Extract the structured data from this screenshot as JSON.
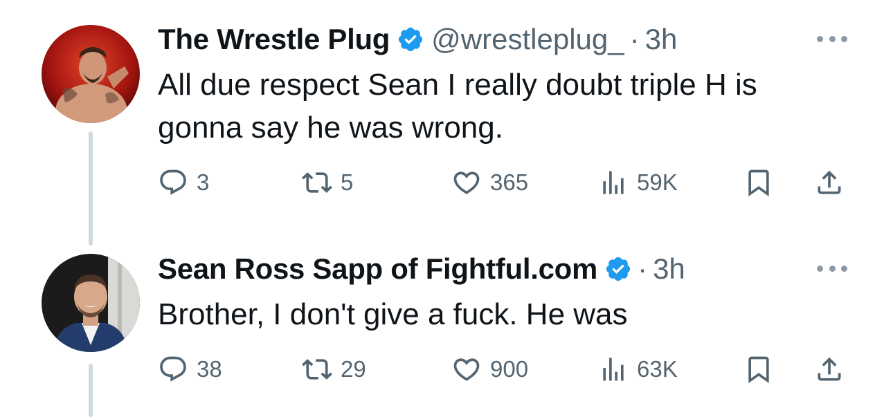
{
  "tweets": [
    {
      "author_name": "The Wrestle Plug",
      "handle": "@wrestleplug_",
      "separator": "·",
      "time": "3h",
      "text": "All due respect Sean I really doubt triple H is gonna say he was wrong.",
      "replies": "3",
      "reposts": "5",
      "likes": "365",
      "views": "59K"
    },
    {
      "author_name": "Sean Ross Sapp of Fightful.com",
      "handle": "",
      "separator": "·",
      "time": "3h",
      "text": "Brother, I don't give a fuck. He was",
      "replies": "38",
      "reposts": "29",
      "likes": "900",
      "views": "63K"
    }
  ],
  "colors": {
    "verified": "#1d9bf0",
    "muted": "#536471",
    "thread_line": "#cfd9de"
  },
  "icons": [
    "reply-icon",
    "repost-icon",
    "like-icon",
    "views-icon",
    "bookmark-icon",
    "share-icon",
    "more-icon",
    "verified-badge-icon"
  ]
}
